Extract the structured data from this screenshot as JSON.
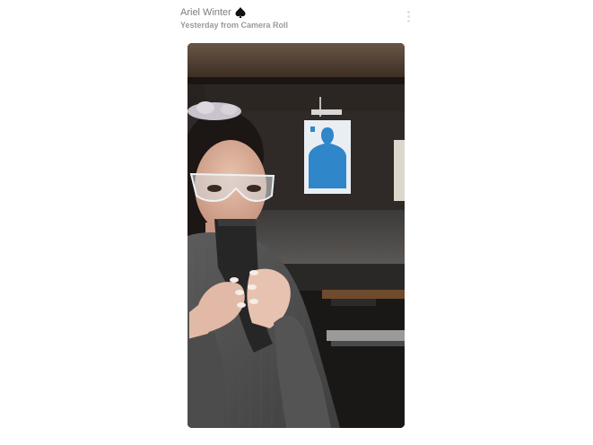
{
  "story": {
    "user_name": "Ariel Winter",
    "badge_icon": "spade-icon",
    "subtitle": "Yesterday from Camera Roll",
    "more_icon": "vertical-ellipsis-icon"
  },
  "media": {
    "kind": "photo",
    "content": "selfie at a shooting range"
  },
  "colors": {
    "background": "#ffffff",
    "name_text": "#7d7d7d",
    "subtitle_text": "#9a9a9a",
    "target_blue": "#2f86c9"
  }
}
